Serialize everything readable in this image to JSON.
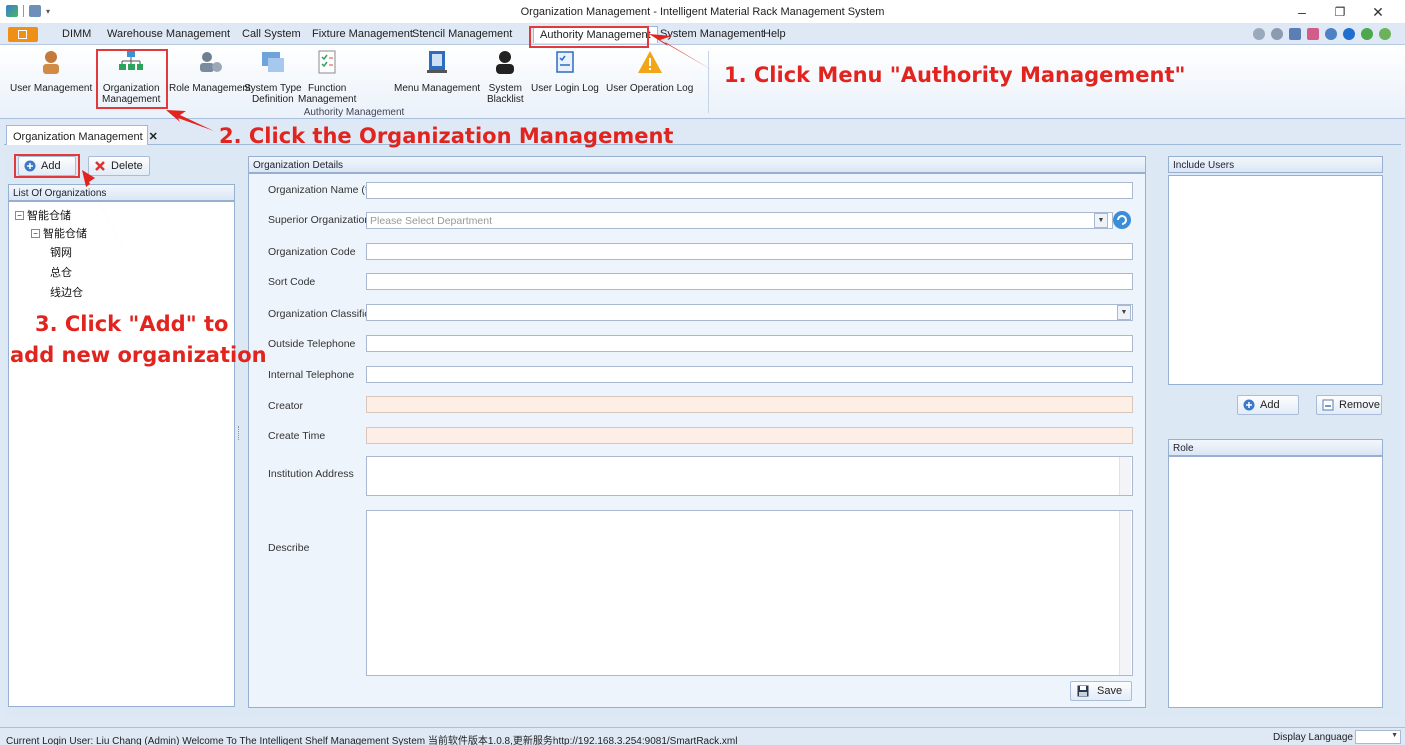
{
  "window": {
    "title": "Organization Management - Intelligent Material Rack Management System",
    "minimize": "–",
    "restore": "❐",
    "close": "✕"
  },
  "menu": {
    "items": [
      "DIMM",
      "Warehouse Management",
      "Call System",
      "Fixture Management",
      "Stencil Management",
      "Authority Management",
      "System Management",
      "Help"
    ],
    "active": "Authority Management"
  },
  "ribbon": {
    "buttons": [
      "User Management",
      "Organization Management",
      "Role Management",
      "System Type Definition",
      "Function Management",
      "Menu Management",
      "System Blacklist",
      "User Login Log",
      "User Operation Log"
    ],
    "split_labels": {
      "org_1": "Organization",
      "org_2": "Management",
      "systype_1": "System Type",
      "systype_2": "Definition",
      "func_1": "Function",
      "func_2": "Management",
      "black_1": "System",
      "black_2": "Blacklist"
    },
    "group_label": "Authority Management"
  },
  "doc_tab": {
    "label": "Organization Management",
    "close": "✕"
  },
  "left": {
    "add_label": "Add",
    "delete_label": "Delete",
    "list_header": "List Of Organizations",
    "tree": {
      "root": "智能仓储",
      "child": "智能仓储",
      "leaves": [
        "钢网",
        "总仓",
        "线边仓"
      ]
    }
  },
  "details": {
    "header": "Organization Details",
    "labels": {
      "name": "Organization Name (*)",
      "superior": "Superior Organization",
      "code": "Organization Code",
      "sort": "Sort Code",
      "classification": "Organization Classification",
      "outside_tel": "Outside Telephone",
      "internal_tel": "Internal Telephone",
      "creator": "Creator",
      "create_time": "Create Time",
      "address": "Institution Address",
      "describe": "Describe"
    },
    "superior_placeholder": "Please Select Department",
    "save_label": "Save"
  },
  "right": {
    "include_users_header": "Include Users",
    "add_label": "Add",
    "remove_label": "Remove",
    "role_header": "Role"
  },
  "annotations": {
    "step1": "1. Click Menu \"Authority Management\"",
    "step2": "2. Click the Organization Management",
    "step3_line1": "3. Click \"Add\" to",
    "step3_line2": "add new organization",
    "color": "#e2241f"
  },
  "status": {
    "text": "Current Login User: Liu Chang (Admin)  Welcome To The Intelligent Shelf Management System  当前软件版本1.0.8,更新服务http://192.168.3.254:9081/SmartRack.xml",
    "language_label": "Display Language"
  }
}
